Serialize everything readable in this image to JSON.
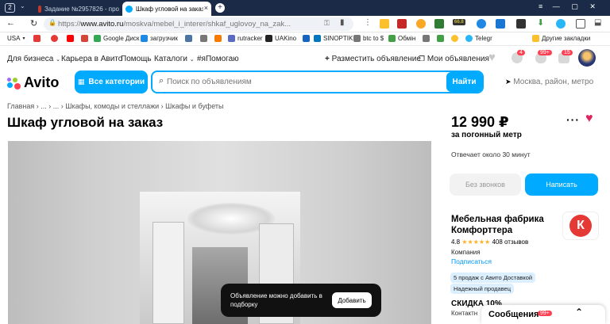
{
  "browser": {
    "tab_count": "2",
    "tabs": [
      {
        "label": "Задание №2957826 - про"
      },
      {
        "label": "Шкаф угловой на заказ"
      }
    ],
    "url_prefix": "https://",
    "url_host": "www.avito.ru",
    "url_path": "/moskva/mebel_i_interer/shkaf_uglovoy_na_zak...",
    "ext_badge": "66.8"
  },
  "bookmarks": [
    {
      "label": "USA",
      "color": "#777"
    },
    {
      "label": "",
      "color": "#e53935"
    },
    {
      "label": "",
      "color": "#e53935"
    },
    {
      "label": "",
      "color": "#ff0000"
    },
    {
      "label": "",
      "color": "#d44638"
    },
    {
      "label": "Google Диск",
      "color": "#34a853"
    },
    {
      "label": "загрузчик",
      "color": "#1e88e5"
    },
    {
      "label": "",
      "color": "#4c75a3"
    },
    {
      "label": "",
      "color": "#777"
    },
    {
      "label": "",
      "color": "#f57c00"
    },
    {
      "label": "rutracker",
      "color": "#5c6bc0"
    },
    {
      "label": "UAKino",
      "color": "#222"
    },
    {
      "label": "",
      "color": "#1565c0"
    },
    {
      "label": "SINOPTIK",
      "color": "#0277bd"
    },
    {
      "label": "btc to $",
      "color": "#777"
    },
    {
      "label": "Обмін",
      "color": "#43a047"
    },
    {
      "label": "",
      "color": "#777"
    },
    {
      "label": "",
      "color": "#43a047"
    },
    {
      "label": "",
      "color": "#fbc02d"
    },
    {
      "label": "Telegr",
      "color": "#29b6f6"
    },
    {
      "label": "Другие закладки",
      "color": "#fbc02d"
    }
  ],
  "header": {
    "nav": [
      "Для бизнеса",
      "Карьера в Авито",
      "Помощь",
      "Каталоги",
      "#яПомогаю"
    ],
    "post_ad": "Разместить объявление",
    "my_ads": "Мои объявления",
    "badges": [
      "4",
      "99+",
      "15"
    ],
    "logo": "Avito",
    "categories_button": "Все категории",
    "search_placeholder": "Поиск по объявлениям",
    "search_button": "Найти",
    "location": "Москва, район, метро"
  },
  "listing": {
    "breadcrumbs": [
      "Главная",
      "...",
      "...",
      "Шкафы, комоды и стеллажи",
      "Шкафы и буфеты"
    ],
    "title": "Шкаф угловой на заказ",
    "price": "12 990 ₽",
    "price_unit": "за погонный метр",
    "response_time": "Отвечает около 30 минут",
    "no_calls_button": "Без звонков",
    "write_button": "Написать"
  },
  "seller": {
    "name": "Мебельная фабрика Комфорттера",
    "rating": "4.8",
    "stars": "★★★★★",
    "reviews": "408 отзывов",
    "type": "Компания",
    "subscribe": "Подписаться",
    "tags": [
      "5 продаж с Авито Доставкой",
      "Надежный продавец"
    ],
    "discount": "СКИДКА 10%",
    "contacts": "Контактн"
  },
  "toast": {
    "text": "Объявление можно добавить в подборку",
    "button": "Добавить"
  },
  "messages": {
    "label": "Сообщения",
    "badge": "99+"
  },
  "colors": {
    "accent": "#00aaff",
    "favorite": "#e0245e",
    "browser_frame": "#1b2b47"
  }
}
